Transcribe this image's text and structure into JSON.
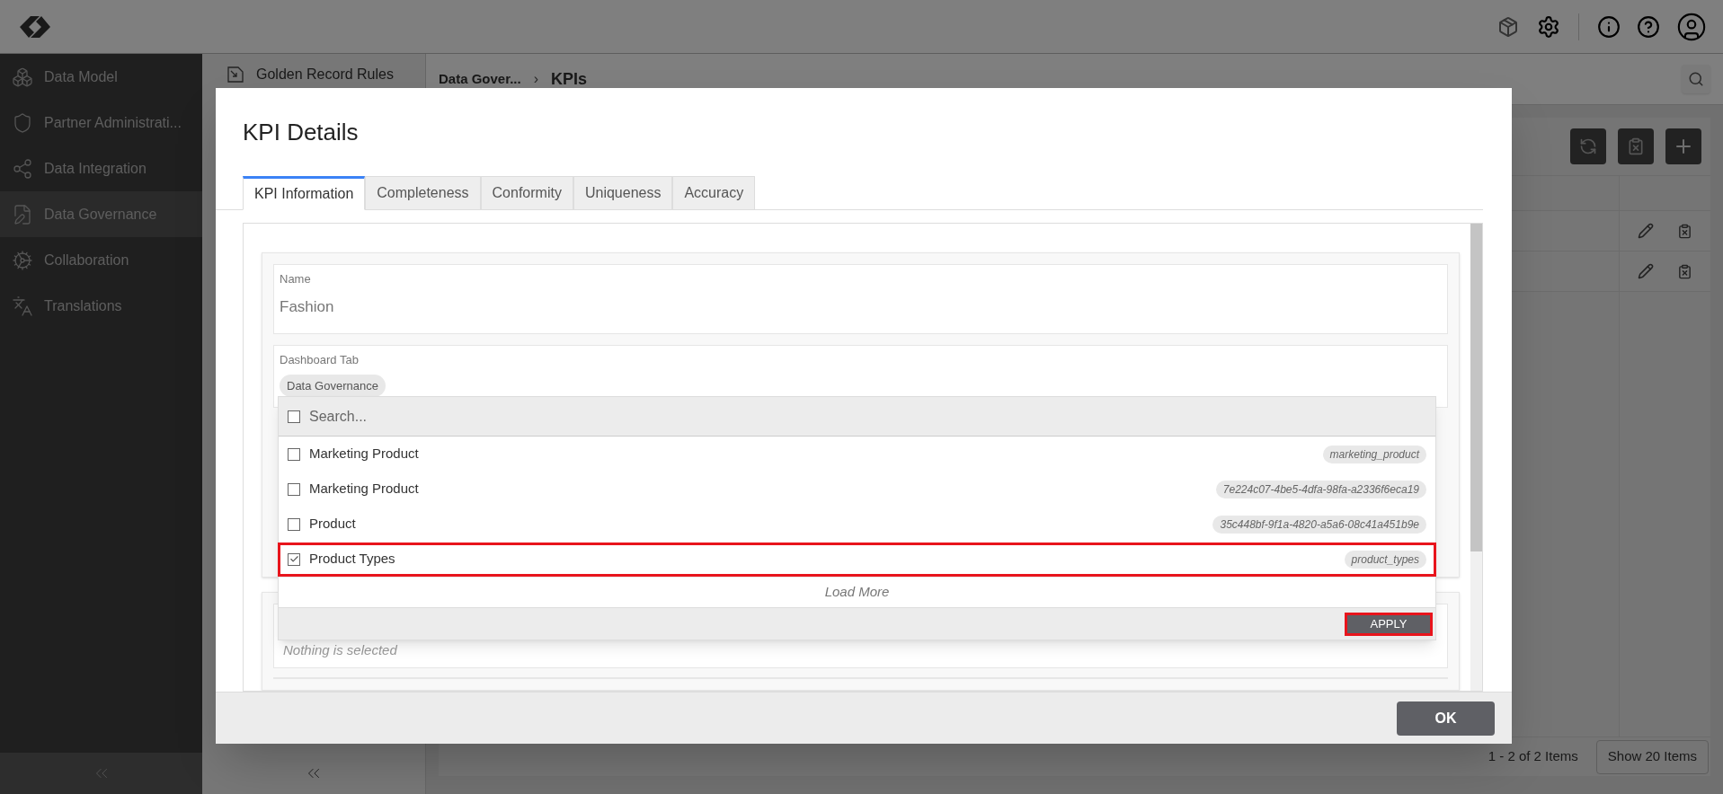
{
  "sidebar": {
    "items": [
      {
        "label": "Data Model",
        "selected": false
      },
      {
        "label": "Partner Administrati...",
        "selected": false
      },
      {
        "label": "Data Integration",
        "selected": false
      },
      {
        "label": "Data Governance",
        "selected": true
      },
      {
        "label": "Collaboration",
        "selected": false
      },
      {
        "label": "Translations",
        "selected": false
      }
    ]
  },
  "subpanel": {
    "item": "Golden Record Rules"
  },
  "breadcrumb": [
    "Data Gover...",
    "KPIs"
  ],
  "breadcrumb_separator": "›",
  "pagination": {
    "summary": "1 - 2 of 2 Items",
    "page_size_button": "Show 20 Items"
  },
  "modal": {
    "title": "KPI Details",
    "tabs": [
      {
        "label": "KPI Information",
        "selected": true
      },
      {
        "label": "Completeness",
        "selected": false
      },
      {
        "label": "Conformity",
        "selected": false
      },
      {
        "label": "Uniqueness",
        "selected": false
      },
      {
        "label": "Accuracy",
        "selected": false
      }
    ],
    "name_field": {
      "label": "Name",
      "value": "Fashion"
    },
    "dashboard_tab": {
      "label": "Dashboard Tab",
      "chips": [
        "Data Governance"
      ]
    },
    "dropdown": {
      "search_placeholder": "Search...",
      "select_all_checked": false,
      "options": [
        {
          "label": "Marketing Product",
          "tag": "marketing_product",
          "checked": false,
          "highlighted": false
        },
        {
          "label": "Marketing Product",
          "tag": "7e224c07-4be5-4dfa-98fa-a2336f6eca19",
          "checked": false,
          "highlighted": false
        },
        {
          "label": "Product",
          "tag": "35c448bf-9f1a-4820-a5a6-08c41a451b9e",
          "checked": false,
          "highlighted": false
        },
        {
          "label": "Product Types",
          "tag": "product_types",
          "checked": true,
          "highlighted": true
        }
      ],
      "load_more": "Load More",
      "apply": "APPLY",
      "apply_highlighted": true
    },
    "empty_field": {
      "placeholder": "Nothing is selected"
    },
    "ok": "OK"
  }
}
